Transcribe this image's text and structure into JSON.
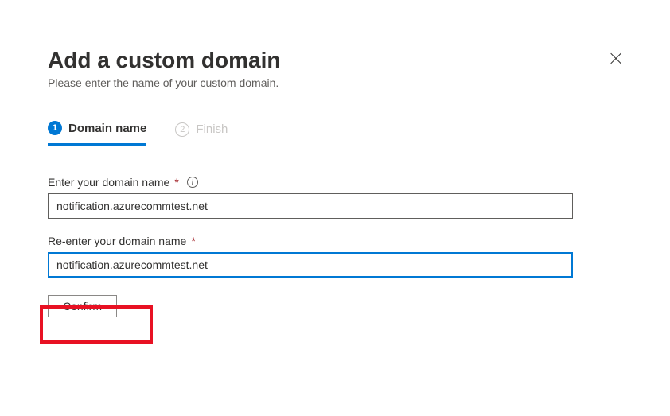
{
  "header": {
    "title": "Add a custom domain",
    "subtitle": "Please enter the name of your custom domain."
  },
  "steps": [
    {
      "number": "1",
      "label": "Domain name"
    },
    {
      "number": "2",
      "label": "Finish"
    }
  ],
  "form": {
    "field1_label": "Enter your domain name",
    "field1_value": "notification.azurecommtest.net",
    "field2_label": "Re-enter your domain name",
    "field2_value": "notification.azurecommtest.net",
    "confirm_label": "Confirm"
  }
}
